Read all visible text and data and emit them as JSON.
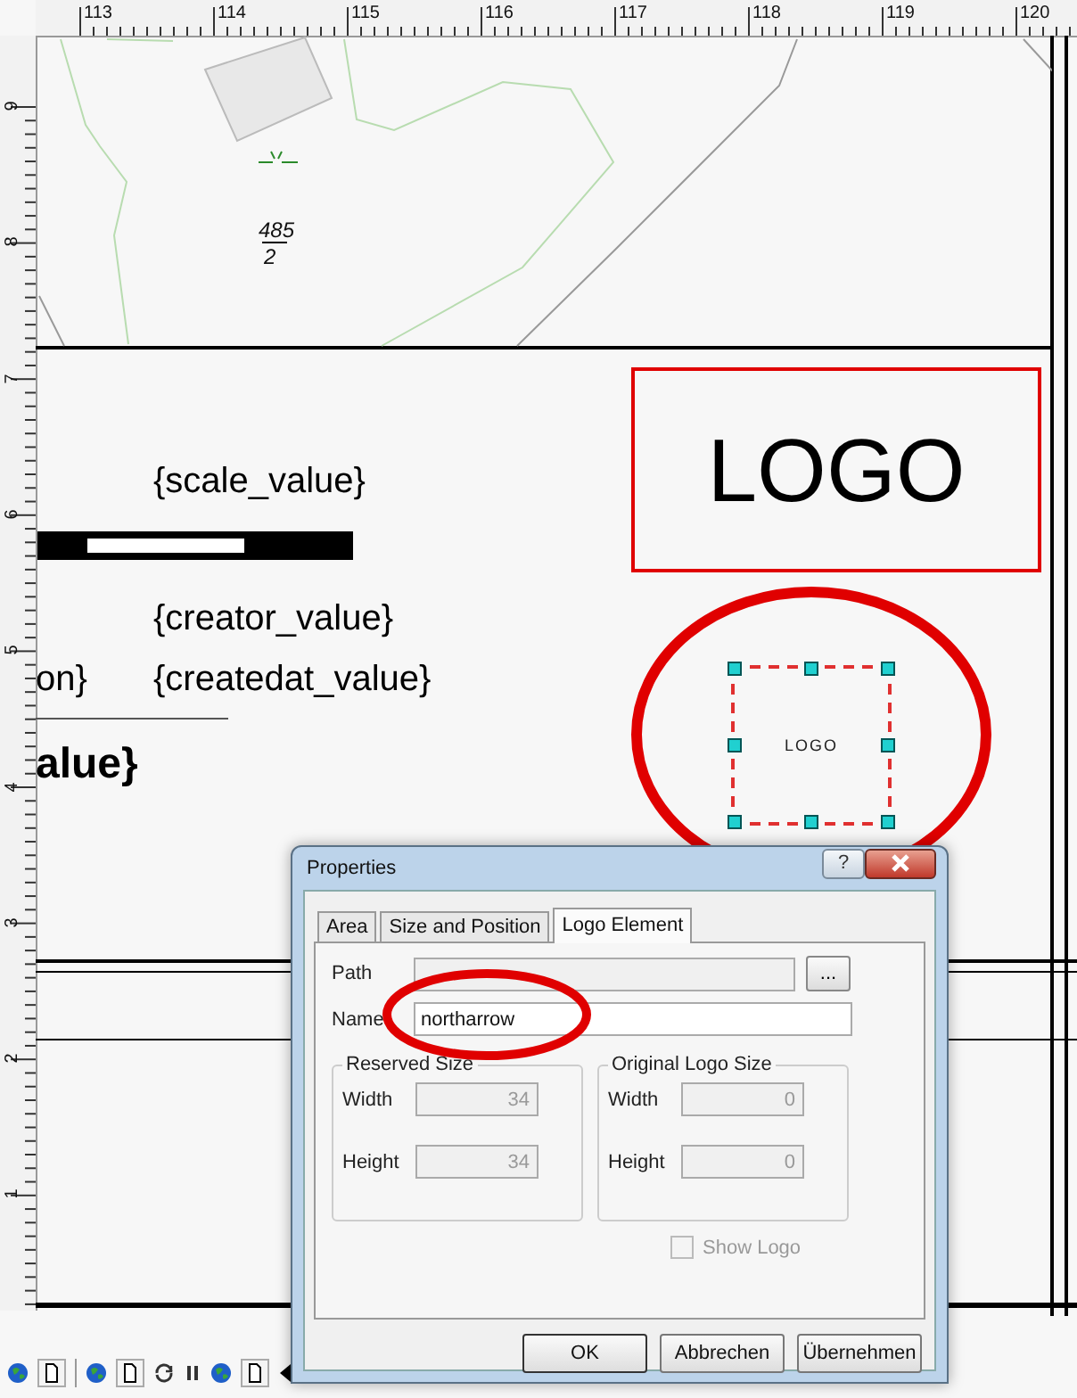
{
  "ruler_top": {
    "labels": [
      "113",
      "114",
      "115",
      "116",
      "117",
      "118",
      "119",
      "120"
    ]
  },
  "ruler_left": {
    "labels": [
      "9",
      "8",
      "7",
      "6",
      "5",
      "4",
      "3",
      "2",
      "1"
    ]
  },
  "map": {
    "numerator": "485",
    "denominator": "2"
  },
  "layout": {
    "scale_text": "{scale_value}",
    "creator_text": "{creator_value}",
    "partial_label": "on}",
    "createdat_text": "{createdat_value}",
    "title_partial": "alue}",
    "logo_box": {
      "text": "LOGO"
    },
    "logo_element": {
      "text": "LOGO",
      "selected": true
    }
  },
  "dialog": {
    "title": "Properties",
    "help_button": "?",
    "tabs": [
      {
        "label": "Area",
        "selected": false
      },
      {
        "label": "Size and Position",
        "selected": false
      },
      {
        "label": "Logo Element",
        "selected": true
      }
    ],
    "path": {
      "label": "Path"
    },
    "browse_button": "...",
    "name": {
      "label": "Name",
      "value": "northarrow"
    },
    "groups": [
      {
        "title": "Reserved Size",
        "fields": [
          {
            "label": "Width",
            "value": "34",
            "disabled": true
          },
          {
            "label": "Height",
            "value": "34",
            "disabled": true
          }
        ]
      },
      {
        "title": "Original Logo Size",
        "fields": [
          {
            "label": "Width",
            "value": "0",
            "disabled": true
          },
          {
            "label": "Height",
            "value": "0",
            "disabled": true
          }
        ]
      }
    ],
    "show_logo": {
      "label": "Show Logo",
      "checked": false,
      "disabled": true
    },
    "buttons": [
      "OK",
      "Abbrechen",
      "Übernehmen"
    ]
  }
}
